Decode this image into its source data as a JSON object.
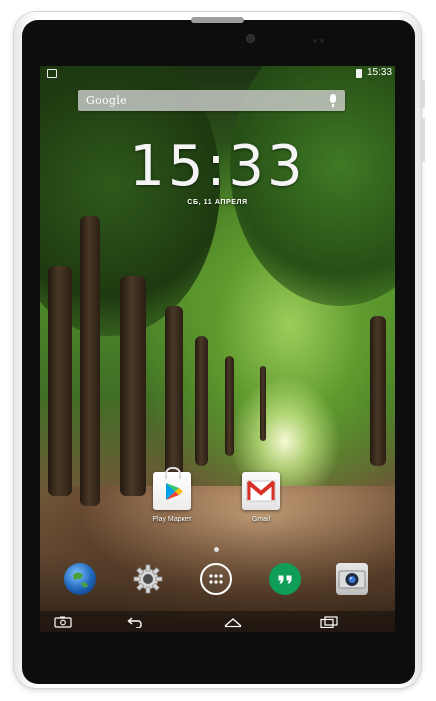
{
  "statusbar": {
    "time": "15:33"
  },
  "search": {
    "label": "Google"
  },
  "lockscreen": {
    "time": "15:33",
    "date": "СБ, 11 АПРЕЛЯ"
  },
  "apps": [
    {
      "label": "Play Маркет"
    },
    {
      "label": "Gmail"
    }
  ],
  "colors": {
    "accent_hangouts": "#0f9d58",
    "gmail_red": "#d93025"
  },
  "icons": {
    "dock": [
      "globe-icon",
      "gear-icon",
      "app-drawer-icon",
      "hangouts-icon",
      "camera-icon"
    ],
    "nav": [
      "screenshot-icon",
      "back-icon",
      "home-icon",
      "recents-icon"
    ]
  }
}
